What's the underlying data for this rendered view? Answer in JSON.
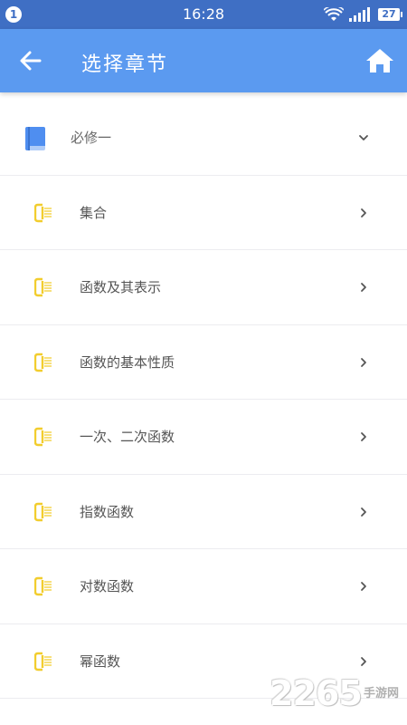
{
  "status_bar": {
    "notification_count": "1",
    "time": "16:28",
    "battery": "27",
    "icons": [
      "wifi-icon",
      "signal-icon",
      "battery-icon"
    ]
  },
  "app_bar": {
    "title": "选择章节",
    "back_icon": "arrow-left-icon",
    "home_icon": "home-icon",
    "color": "#5b9af0"
  },
  "section": {
    "label": "必修一",
    "icon": "book-icon",
    "expanded": true
  },
  "chapters": [
    {
      "label": "集合"
    },
    {
      "label": "函数及其表示"
    },
    {
      "label": "函数的基本性质"
    },
    {
      "label": "一次、二次函数"
    },
    {
      "label": "指数函数"
    },
    {
      "label": "对数函数"
    },
    {
      "label": "幂函数"
    }
  ],
  "colors": {
    "status_bar": "#3f6fc4",
    "book_icon": "#4f8ef0",
    "chapter_icon": "#f2cd2e"
  },
  "watermark": {
    "digits": "2265",
    "text": "手游网"
  }
}
